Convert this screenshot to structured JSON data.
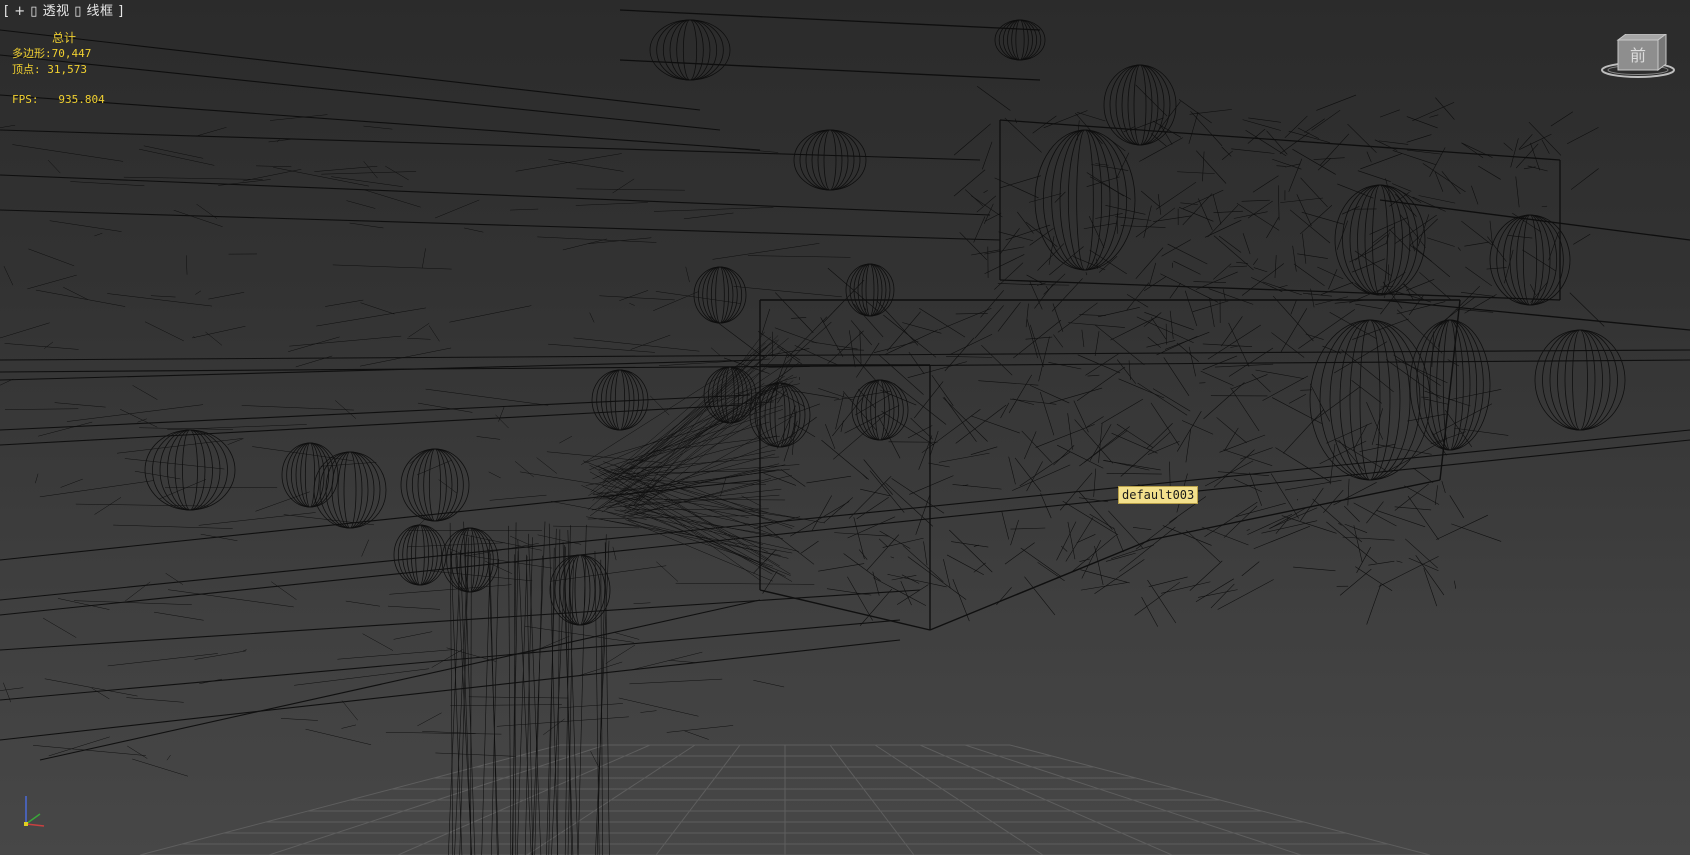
{
  "viewport": {
    "label_open": "[",
    "plus_menu": "+",
    "view_menu": "透视",
    "shading_menu": "线框",
    "label_close": "]"
  },
  "stats": {
    "heading": "总计",
    "polygons_label": "多边形:",
    "polygons_value": "70,447",
    "vertices_label": "顶点:",
    "vertices_value": "31,573",
    "fps_label": "FPS:",
    "fps_value": "935.804"
  },
  "tooltip": {
    "object_name": "default003"
  },
  "viewcube": {
    "face_label": "前"
  },
  "colors": {
    "stats_text": "#f0d030",
    "tooltip_bg": "#f3e08c",
    "wire": "#0a0a0a",
    "grid": "#5a5a5a"
  }
}
